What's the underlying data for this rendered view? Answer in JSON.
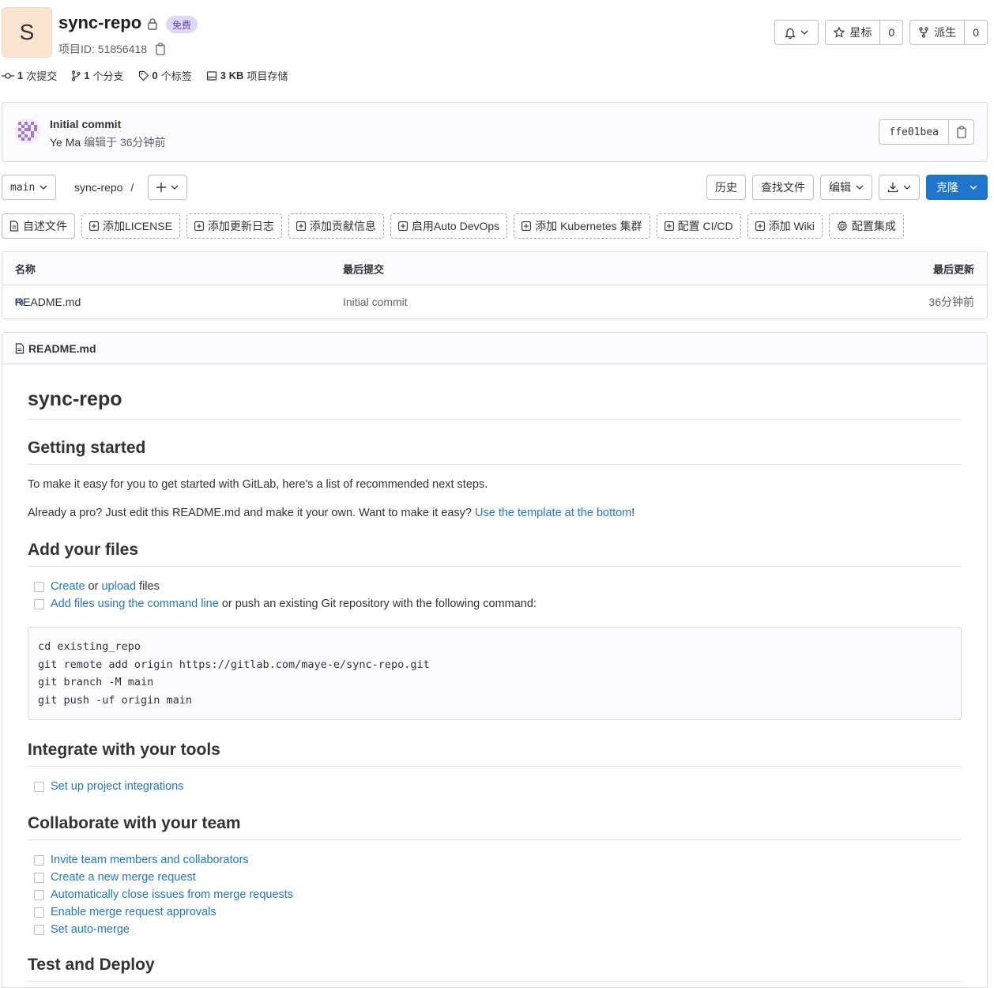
{
  "project": {
    "avatar_letter": "S",
    "name": "sync-repo",
    "badge": "免费",
    "id_label": "项目ID: 51856418"
  },
  "actions": {
    "star_label": "星标",
    "star_count": "0",
    "fork_label": "派生",
    "fork_count": "0"
  },
  "stats": {
    "commits_num": "1",
    "commits_label": "次提交",
    "branches_num": "1",
    "branches_label": "个分支",
    "tags_num": "0",
    "tags_label": "个标签",
    "storage_num": "3 KB",
    "storage_label": "项目存储"
  },
  "commit": {
    "title": "Initial commit",
    "author": "Ye Ma",
    "meta": "编辑于 36分钟前",
    "sha": "ffe01bea"
  },
  "nav": {
    "branch": "main",
    "path": "sync-repo",
    "separator": "/",
    "history": "历史",
    "find_file": "查找文件",
    "edit": "编辑",
    "clone": "克隆"
  },
  "quick_actions": [
    "自述文件",
    "添加LICENSE",
    "添加更新日志",
    "添加贡献信息",
    "启用Auto DevOps",
    "添加 Kubernetes 集群",
    "配置 CI/CD",
    "添加 Wiki",
    "配置集成"
  ],
  "table": {
    "headers": {
      "name": "名称",
      "last_commit": "最后提交",
      "last_update": "最后更新"
    },
    "rows": [
      {
        "name": "README.md",
        "commit": "Initial commit",
        "updated": "36分钟前"
      }
    ]
  },
  "readme": {
    "filename": "README.md",
    "h1": "sync-repo",
    "s1_title": "Getting started",
    "s1_p1": "To make it easy for you to get started with GitLab, here's a list of recommended next steps.",
    "s1_p2_text": "Already a pro? Just edit this README.md and make it your own. Want to make it easy? ",
    "s1_p2_link": "Use the template at the bottom",
    "s1_p2_end": "!",
    "s2_title": "Add your files",
    "s2_item1_link1": "Create",
    "s2_item1_mid": " or ",
    "s2_item1_link2": "upload",
    "s2_item1_end": " files",
    "s2_item2_link": "Add files using the command line",
    "s2_item2_end": " or push an existing Git repository with the following command:",
    "code": "cd existing_repo\ngit remote add origin https://gitlab.com/maye-e/sync-repo.git\ngit branch -M main\ngit push -uf origin main",
    "s3_title": "Integrate with your tools",
    "s3_items": [
      "Set up project integrations"
    ],
    "s4_title": "Collaborate with your team",
    "s4_items": [
      "Invite team members and collaborators",
      "Create a new merge request",
      "Automatically close issues from merge requests",
      "Enable merge request approvals",
      "Set auto-merge"
    ],
    "s5_title": "Test and Deploy"
  }
}
